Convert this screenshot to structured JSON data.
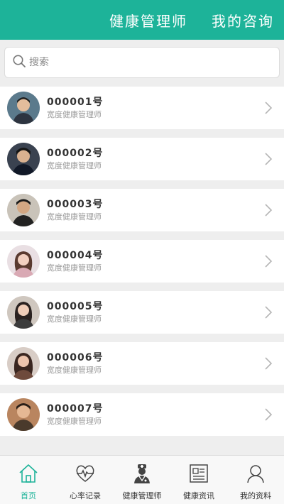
{
  "header": {
    "tabs": [
      {
        "label": "健康管理师"
      },
      {
        "label": "我的咨询"
      }
    ]
  },
  "search": {
    "placeholder": "搜索",
    "value": ""
  },
  "list": {
    "items": [
      {
        "title": "000001号",
        "subtitle": "宽度健康管理师",
        "avatar": "male-avatar"
      },
      {
        "title": "000002号",
        "subtitle": "宽度健康管理师",
        "avatar": "male-avatar"
      },
      {
        "title": "000003号",
        "subtitle": "宽度健康管理师",
        "avatar": "male-avatar"
      },
      {
        "title": "000004号",
        "subtitle": "宽度健康管理师",
        "avatar": "female-avatar"
      },
      {
        "title": "000005号",
        "subtitle": "宽度健康管理师",
        "avatar": "female-avatar"
      },
      {
        "title": "000006号",
        "subtitle": "宽度健康管理师",
        "avatar": "female-avatar"
      },
      {
        "title": "000007号",
        "subtitle": "宽度健康管理师",
        "avatar": "male-avatar"
      }
    ]
  },
  "tabbar": {
    "items": [
      {
        "label": "首页",
        "icon": "home-icon"
      },
      {
        "label": "心率记录",
        "icon": "heart-rate-icon"
      },
      {
        "label": "健康管理师",
        "icon": "doctor-icon"
      },
      {
        "label": "健康资讯",
        "icon": "news-icon"
      },
      {
        "label": "我的资料",
        "icon": "profile-icon"
      }
    ],
    "active": "首页"
  },
  "colors": {
    "accent": "#1db399",
    "background": "#eeeeee",
    "text_primary": "#333333",
    "text_secondary": "#9a9a9a"
  }
}
